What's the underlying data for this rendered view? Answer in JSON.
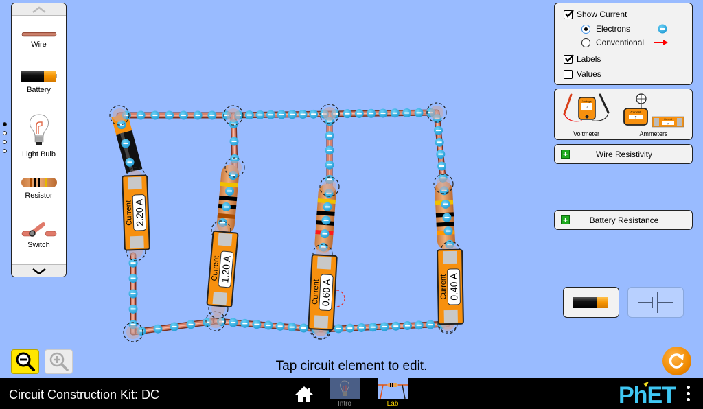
{
  "app": {
    "title": "Circuit Construction Kit: DC",
    "hint": "Tap circuit element to edit."
  },
  "toolbox": {
    "items": [
      {
        "label": "Wire",
        "icon": "wire-icon"
      },
      {
        "label": "Battery",
        "icon": "battery-icon"
      },
      {
        "label": "Light Bulb",
        "icon": "light-bulb-icon"
      },
      {
        "label": "Resistor",
        "icon": "resistor-icon"
      },
      {
        "label": "Switch",
        "icon": "switch-icon"
      }
    ],
    "page_count": 4,
    "active_page": 1
  },
  "display_options": {
    "show_current": {
      "label": "Show Current",
      "checked": true
    },
    "current_types": [
      {
        "label": "Electrons",
        "selected": true,
        "icon": "electron-icon"
      },
      {
        "label": "Conventional",
        "selected": false,
        "icon": "red-arrow-icon"
      }
    ],
    "labels": {
      "label": "Labels",
      "checked": true
    },
    "values": {
      "label": "Values",
      "checked": false
    }
  },
  "sensor_panel": {
    "voltmeter_label": "Voltmeter",
    "ammeters_label": "Ammeters",
    "voltmeter_text": "Voltage",
    "ammeter_text": "Current",
    "unknown_value": "?"
  },
  "accordions": [
    {
      "label": "Wire Resistivity",
      "expanded": false
    },
    {
      "label": "Battery Resistance",
      "expanded": false
    }
  ],
  "view_toggle": {
    "options": [
      "lifelike",
      "schematic"
    ],
    "selected": "lifelike"
  },
  "ammeters": [
    {
      "label": "Current",
      "value": "2.20 A"
    },
    {
      "label": "Current",
      "value": "1.20 A"
    },
    {
      "label": "Current",
      "value": "0.60 A"
    },
    {
      "label": "Current",
      "value": "0.40 A"
    }
  ],
  "zoom": {
    "zoom_out_enabled": true,
    "zoom_in_enabled": false
  },
  "navbar": {
    "screens": [
      {
        "label": "Intro",
        "selected": false
      },
      {
        "label": "Lab",
        "selected": true
      }
    ],
    "logo": "PhET"
  },
  "colors": {
    "background": "#99bbff",
    "electron": "#29aee6",
    "ammeter_body": "#f7900e",
    "selected_screen_label": "#ffd700",
    "phet_blue": "#3fc8f4",
    "phet_yellow": "#f5e020"
  }
}
